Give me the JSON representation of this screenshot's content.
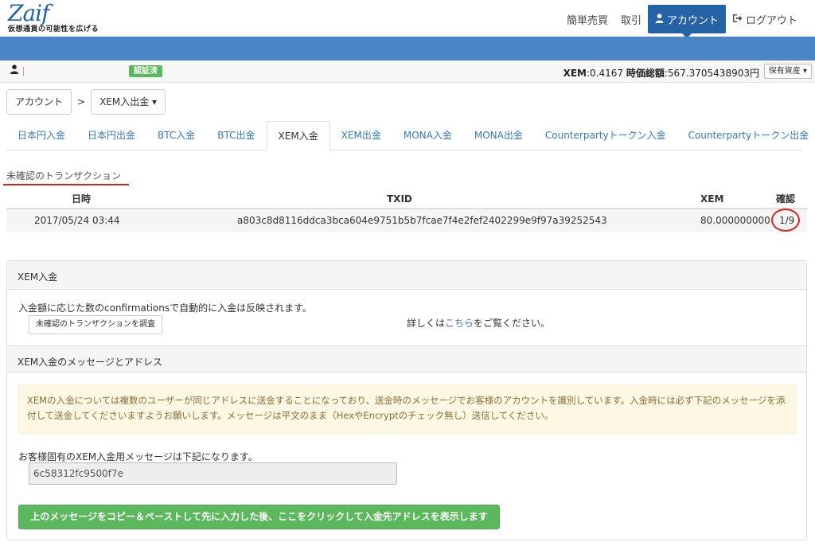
{
  "logo": {
    "main": "Zaif",
    "tagline": "仮想通貨の可能性を広げる"
  },
  "topnav": {
    "simple_trade": "簡単売買",
    "trade": "取引",
    "account": "アカウント",
    "logout": "ログアウト"
  },
  "userbar": {
    "verified": "認証済",
    "balance_currency": "XEM",
    "balance_rate": ":0.4167 ",
    "balance_total_label": "時価総額",
    "balance_total_value": ":567.3705438903円",
    "assets_button": "保有資産 ▾"
  },
  "breadcrumb": {
    "account": "アカウント",
    "separator": ">",
    "current": "XEM入出金 ▾"
  },
  "tabs": [
    {
      "label": "日本円入金"
    },
    {
      "label": "日本円出金"
    },
    {
      "label": "BTC入金"
    },
    {
      "label": "BTC出金"
    },
    {
      "label": "XEM入金"
    },
    {
      "label": "XEM出金"
    },
    {
      "label": "MONA入金"
    },
    {
      "label": "MONA出金"
    },
    {
      "label": "Counterpartyトークン入金"
    },
    {
      "label": "Counterpartyトークン出金"
    }
  ],
  "active_tab": "XEM入金",
  "unconfirmed": {
    "title": "未確認のトランザクション",
    "headers": {
      "date": "日時",
      "txid": "TXID",
      "amount": "XEM",
      "confirm": "確認"
    },
    "rows": [
      {
        "date": "2017/05/24 03:44",
        "txid": "a803c8d8116ddca3bca604e9751b5b7fcae7f4e2fef2402299e9f97a39252543",
        "amount": "80.000000000",
        "confirm": "1/9"
      }
    ]
  },
  "panel": {
    "title": "XEM入金",
    "info_text": "入金額に応じた数のconfirmationsで自動的に入金は反映されます。",
    "check_button": "未確認のトランザクションを調査",
    "detail_prefix": "詳しくは",
    "detail_link": "こちら",
    "detail_suffix": "をご覧ください。",
    "section2_title": "XEM入金のメッセージとアドレス",
    "warning": "XEMの入金については複数のユーザーが同じアドレスに送金することになっており、送金時のメッセージでお客様のアカウントを識別しています。入金時には必ず下記のメッセージを添付して送金してくださいますようお願いします。メッセージは平文のまま（HexやEncryptのチェック無し）送信してください。",
    "message_label": "お客様固有のXEM入金用メッセージは下記になります。",
    "message_value": "6c58312fc9500f7e",
    "show_address_button": "上のメッセージをコピー＆ペーストして先に入力した後、ここをクリックして入金先アドレスを表示します"
  },
  "colors": {
    "brand_blue": "#2562a6",
    "band_blue": "#4a86c6",
    "success_green": "#5cb85c",
    "highlight_red": "#d9241c"
  }
}
